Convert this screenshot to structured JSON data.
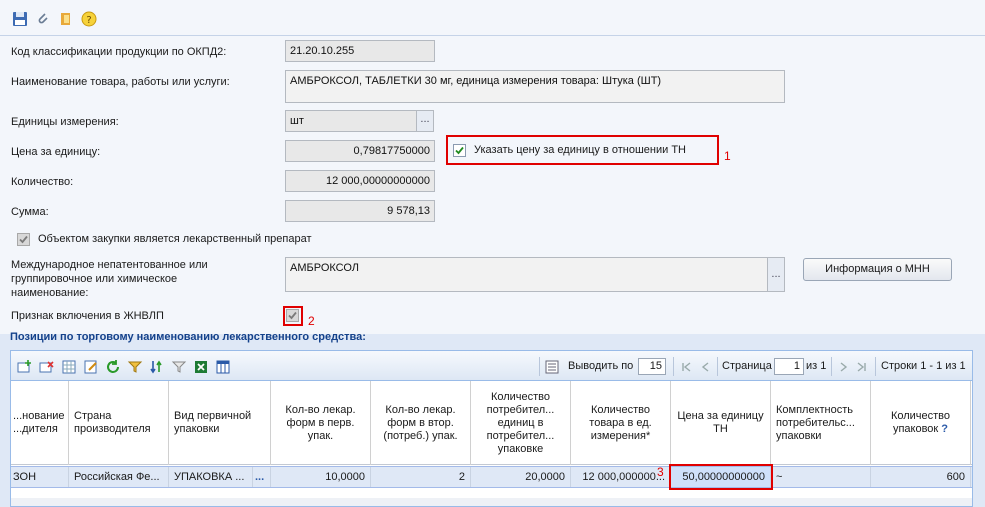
{
  "toolbar": {
    "icons": [
      "save-icon",
      "attach-icon",
      "exit-icon",
      "help-icon"
    ]
  },
  "form": {
    "okpd2": {
      "label": "Код классификации продукции по ОКПД2:",
      "value": "21.20.10.255"
    },
    "name": {
      "label": "Наименование товара, работы или услуги:",
      "value": "АМБРОКСОЛ, ТАБЛЕТКИ 30 мг, единица измерения товара: Штука (ШТ)"
    },
    "unit": {
      "label": "Единицы измерения:",
      "value": "шт",
      "ellipsis": "..."
    },
    "price": {
      "label": "Цена за единицу:",
      "value": "0,79817750000"
    },
    "price_checkbox": {
      "label": "Указать цену за единицу в отношении ТН",
      "checked": true,
      "marker": "1"
    },
    "quantity": {
      "label": "Количество:",
      "value": "12 000,00000000000"
    },
    "sum": {
      "label": "Сумма:",
      "value": "9 578,13"
    },
    "drug_checkbox": {
      "label": "Объектом закупки является лекарственный препарат",
      "checked": true
    },
    "mnn": {
      "label": "Международное непатентованное или группировочное или химическое наименование:",
      "value": "АМБРОКСОЛ",
      "ellipsis": "...",
      "info_button": "Информация о МНН"
    },
    "zhnvlp": {
      "label": "Признак включения в ЖНВЛП",
      "checked": true,
      "marker": "2"
    }
  },
  "section": {
    "title": "Позиции по торговому наименованию лекарственного средства:"
  },
  "grid": {
    "toolbar": {
      "icons": [
        "add-row-icon",
        "delete-row-icon",
        "table-icon",
        "edit-icon",
        "refresh-icon",
        "filter-icon",
        "sort-icon",
        "clear-filter-icon",
        "export-excel-icon",
        "columns-icon"
      ],
      "page_size_label": "Выводить по",
      "page_size": "15",
      "page_label": "Страница",
      "page": "1",
      "page_of": "из 1",
      "rows_info": "Строки 1 - 1 из 1"
    },
    "columns": [
      {
        "label": "...нование ...дителя"
      },
      {
        "label": "Страна производителя"
      },
      {
        "label": "Вид первичной упаковки"
      },
      {
        "label": "Кол-во лекар. форм в перв. упак."
      },
      {
        "label": "Кол-во лекар. форм в втор. (потреб.) упак."
      },
      {
        "label": "Количество потребител... единиц в потребител... упаковке"
      },
      {
        "label": "Количество товара в ед. измерения*"
      },
      {
        "label": "Цена за единицу ТН"
      },
      {
        "label": "Комплектность потребительс... упаковки"
      },
      {
        "label": "Количество упаковок",
        "help": "?"
      }
    ],
    "rows": [
      {
        "c0": "ЗОН",
        "c1": "Российская Фе...",
        "c2": "УПАКОВКА ...",
        "c2_ellipsis": "...",
        "c3": "10,0000",
        "c4": "2",
        "c5": "20,0000",
        "c6": "12 000,000000...",
        "c7": "50,00000000000",
        "c7_marker": "3",
        "c8": "~",
        "c9": "600"
      }
    ]
  },
  "colors": {
    "highlight": "#e00000",
    "section": "#15428b",
    "selected_row": "#dfe8f6"
  }
}
